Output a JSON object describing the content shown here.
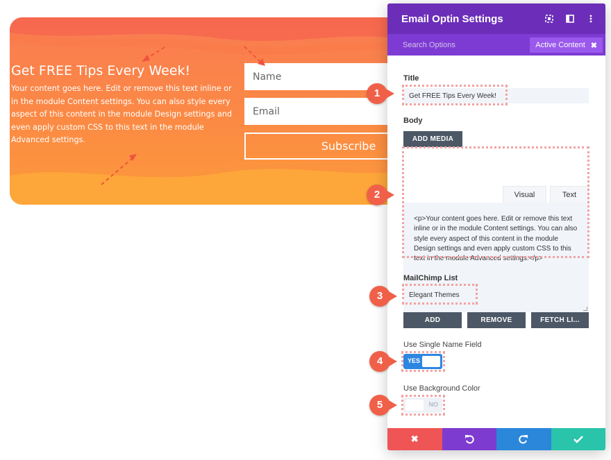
{
  "optin": {
    "title": "Get FREE Tips Every Week!",
    "body": "Your content goes here. Edit or remove this text inline or in the module Content settings. You can also style every aspect of this content in the module Design settings and even apply custom CSS to this text in the module Advanced settings.",
    "name_placeholder": "Name",
    "email_placeholder": "Email",
    "subscribe_label": "Subscribe"
  },
  "panel": {
    "title": "Email Optin Settings",
    "search_label": "Search Options",
    "active_content_label": "Active Content",
    "header_icons": [
      "expand-icon",
      "split-view-icon",
      "more-icon"
    ],
    "title_label": "Title",
    "title_value": "Get FREE Tips Every Week!",
    "body_label": "Body",
    "add_media_label": "ADD MEDIA",
    "tab_visual": "Visual",
    "tab_text": "Text",
    "body_value": "<p>Your content goes here. Edit or remove this text inline or in the module Content settings. You can also style every aspect of this content in the module Design settings and even apply custom CSS to this text in the module Advanced settings.</p>",
    "mailchimp_label": "MailChimp List",
    "mailchimp_value": "Elegant Themes",
    "add_label": "ADD",
    "remove_label": "REMOVE",
    "fetch_label": "FETCH LI...",
    "single_name_label": "Use Single Name Field",
    "single_name_toggle": "YES",
    "bg_color_label": "Use Background Color",
    "bg_color_toggle": "NO"
  },
  "footer": {
    "buttons": [
      {
        "name": "discard-icon",
        "color": "#ef5555"
      },
      {
        "name": "undo-icon",
        "color": "#7e3bd0"
      },
      {
        "name": "redo-icon",
        "color": "#2b87da"
      },
      {
        "name": "save-icon",
        "color": "#29c4a9"
      }
    ]
  },
  "badges": [
    "1",
    "2",
    "3",
    "4",
    "5"
  ],
  "colors": {
    "header": "#6c2eb9",
    "subheader": "#7d3bd3",
    "badge": "#f06049",
    "toggle_on": "#2d87e2"
  }
}
